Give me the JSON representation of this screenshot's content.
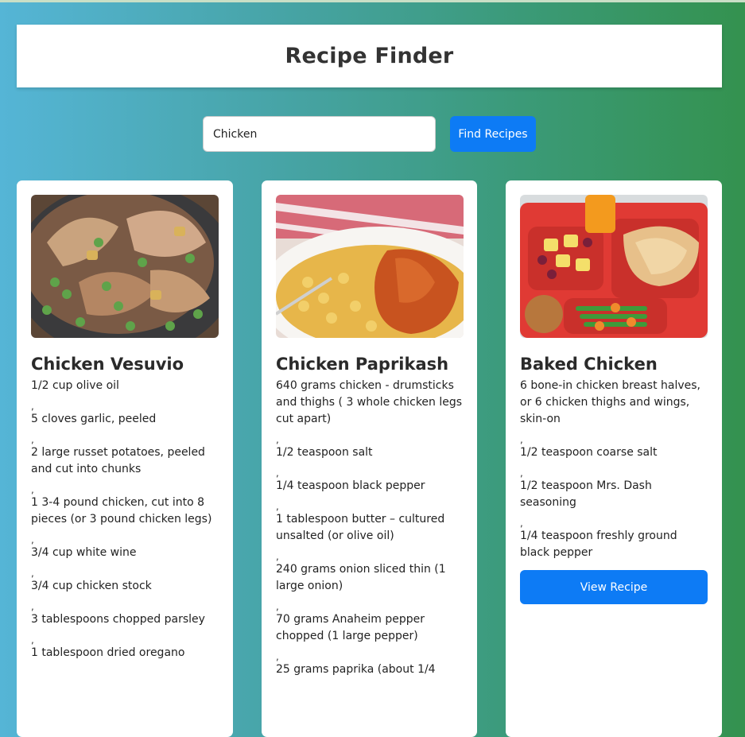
{
  "header": {
    "title": "Recipe Finder"
  },
  "search": {
    "value": "Chicken",
    "button_label": "Find Recipes"
  },
  "recipes": [
    {
      "title": "Chicken Vesuvio",
      "separator": ",",
      "ingredients": [
        "1/2 cup olive oil",
        "5 cloves garlic, peeled",
        "2 large russet potatoes, peeled and cut into chunks",
        "1 3-4 pound chicken, cut into 8 pieces (or 3 pound chicken legs)",
        "3/4 cup white wine",
        "3/4 cup chicken stock",
        "3 tablespoons chopped parsley",
        "1 tablespoon dried oregano"
      ]
    },
    {
      "title": "Chicken Paprikash",
      "separator": ",",
      "ingredients": [
        "640 grams chicken - drumsticks and thighs ( 3 whole chicken legs cut apart)",
        "1/2 teaspoon salt",
        "1/4 teaspoon black pepper",
        "1 tablespoon butter – cultured unsalted (or olive oil)",
        "240 grams onion sliced thin (1 large onion)",
        "70 grams Anaheim pepper chopped (1 large pepper)",
        "25 grams paprika (about 1/4"
      ]
    },
    {
      "title": "Baked Chicken",
      "separator": ",",
      "ingredients": [
        "6 bone-in chicken breast halves, or 6 chicken thighs and wings, skin-on",
        "1/2 teaspoon coarse salt",
        "1/2 teaspoon Mrs. Dash seasoning",
        "1/4 teaspoon freshly ground black pepper"
      ],
      "button_label": "View Recipe"
    }
  ]
}
